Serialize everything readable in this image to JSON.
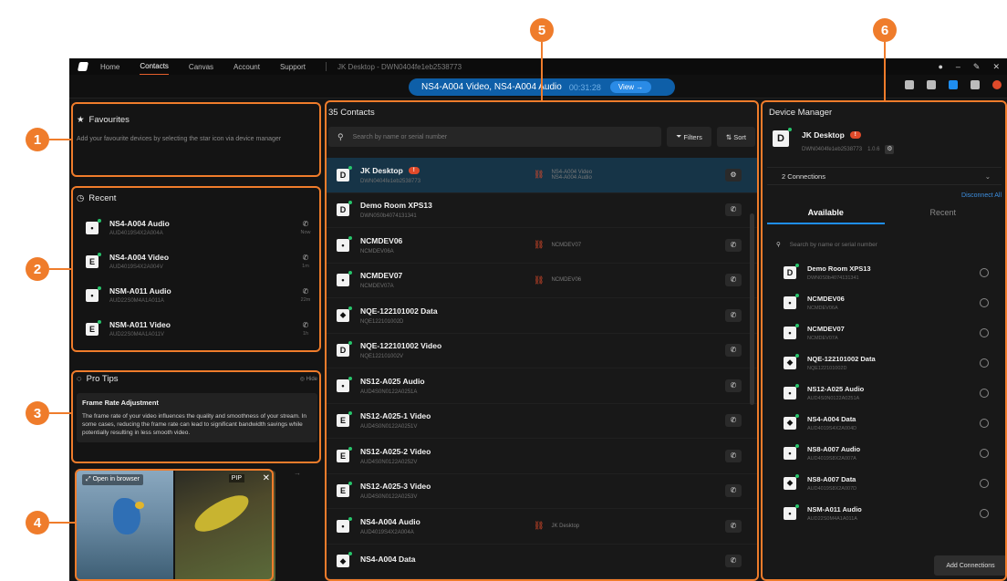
{
  "menubar": {
    "items": [
      "Home",
      "Contacts",
      "Canvas",
      "Account",
      "Support"
    ],
    "active": "Contacts",
    "device_info": "JK Desktop - DWN0404fe1eb2538773"
  },
  "callbar": {
    "title": "NS4-A004 Video, NS4-A004 Audio",
    "timer": "00:31:28",
    "view_label": "View"
  },
  "favourites": {
    "title": "Favourites",
    "description": "Add your favourite devices by selecting the star icon via device manager"
  },
  "recent": {
    "title": "Recent",
    "items": [
      {
        "badge": "•",
        "name": "NS4-A004 Audio",
        "sub": "AUD4019S4X2A004A",
        "time": "Now"
      },
      {
        "badge": "E",
        "name": "NS4-A004 Video",
        "sub": "AUD4019S4X2A004V",
        "time": "1m"
      },
      {
        "badge": "•",
        "name": "NSM-A011 Audio",
        "sub": "AUD22S0M4A1A011A",
        "time": "22m"
      },
      {
        "badge": "E",
        "name": "NSM-A011 Video",
        "sub": "AUD22S0M4A1A011V",
        "time": "1h"
      }
    ]
  },
  "tips": {
    "title": "Pro Tips",
    "hide_label": "Hide",
    "card_title": "Frame Rate Adjustment",
    "card_body": "The frame rate of your video influences the quality and smoothness of your stream. In some cases, reducing the frame rate can lead to significant bandwidth savings while potentially resulting in less smooth video."
  },
  "preview": {
    "open_label": "Open in browser",
    "pin_label": "PIP"
  },
  "contacts": {
    "title": "35 Contacts",
    "search_placeholder": "Search by name or serial number",
    "filters_label": "Filters",
    "sort_label": "Sort",
    "items": [
      {
        "badge": "D",
        "name": "JK Desktop",
        "sub": "DWN0404fe1eb2538773",
        "warn": "!",
        "link": "NS4-A004 Video\nNS4-A004 Audio",
        "selected": true
      },
      {
        "badge": "D",
        "name": "Demo Room XPS13",
        "sub": "DWN0S0b4074131341",
        "warn": "",
        "link": "",
        "selected": false
      },
      {
        "badge": "•",
        "name": "NCMDEV06",
        "sub": "NCMDEV06A",
        "warn": "",
        "link": "NCMDEV07",
        "selected": false
      },
      {
        "badge": "•",
        "name": "NCMDEV07",
        "sub": "NCMDEV07A",
        "warn": "",
        "link": "NCMDEV06",
        "selected": false
      },
      {
        "badge": "⬥",
        "name": "NQE-122101002 Data",
        "sub": "NQE122101002D",
        "warn": "",
        "link": "",
        "selected": false
      },
      {
        "badge": "D",
        "name": "NQE-122101002 Video",
        "sub": "NQE122101002V",
        "warn": "",
        "link": "",
        "selected": false
      },
      {
        "badge": "•",
        "name": "NS12-A025 Audio",
        "sub": "AUD4S0N0122A0251A",
        "warn": "",
        "link": "",
        "selected": false
      },
      {
        "badge": "E",
        "name": "NS12-A025-1 Video",
        "sub": "AUD4S0N0122A0251V",
        "warn": "",
        "link": "",
        "selected": false
      },
      {
        "badge": "E",
        "name": "NS12-A025-2 Video",
        "sub": "AUD4S0N0122A0252V",
        "warn": "",
        "link": "",
        "selected": false
      },
      {
        "badge": "E",
        "name": "NS12-A025-3 Video",
        "sub": "AUD4S0N0122A0253V",
        "warn": "",
        "link": "",
        "selected": false
      },
      {
        "badge": "•",
        "name": "NS4-A004 Audio",
        "sub": "AUD4019S4X2A004A",
        "warn": "",
        "link": "JK Desktop",
        "selected": false
      },
      {
        "badge": "⬥",
        "name": "NS4-A004 Data",
        "sub": "",
        "warn": "",
        "link": "",
        "selected": false
      }
    ]
  },
  "device_manager": {
    "title": "Device Manager",
    "host_badge": "D",
    "host_name": "JK Desktop",
    "host_warn": "!",
    "host_sub": "DWN0404fe1eb2538773",
    "host_version": "1.0.6",
    "connections_label": "2 Connections",
    "disconnect_label": "Disconnect All",
    "tabs": [
      "Available",
      "Recent"
    ],
    "search_placeholder": "Search by name or serial number",
    "items": [
      {
        "badge": "D",
        "name": "Demo Room XPS13",
        "sub": "DWN0S0b4074131341"
      },
      {
        "badge": "•",
        "name": "NCMDEV06",
        "sub": "NCMDEV06A"
      },
      {
        "badge": "•",
        "name": "NCMDEV07",
        "sub": "NCMDEV07A"
      },
      {
        "badge": "⬥",
        "name": "NQE-122101002 Data",
        "sub": "NQE122101002D"
      },
      {
        "badge": "•",
        "name": "NS12-A025 Audio",
        "sub": "AUD4S0N0122A0251A"
      },
      {
        "badge": "⬥",
        "name": "NS4-A004 Data",
        "sub": "AUD4019S4X2A004D"
      },
      {
        "badge": "•",
        "name": "NS8-A007 Audio",
        "sub": "AUD4019S8X2A007A"
      },
      {
        "badge": "⬥",
        "name": "NS8-A007 Data",
        "sub": "AUD4019S8X2A007D"
      },
      {
        "badge": "•",
        "name": "NSM-A011 Audio",
        "sub": "AUD22S0M4A1A011A"
      }
    ],
    "add_label": "Add Connections"
  },
  "callouts": [
    "1",
    "2",
    "3",
    "4",
    "5",
    "6"
  ],
  "colors": {
    "accent": "#ef7c2b",
    "call_blue": "#0e5fa8",
    "warn_red": "#e04a2a",
    "selected_row": "#163447"
  }
}
